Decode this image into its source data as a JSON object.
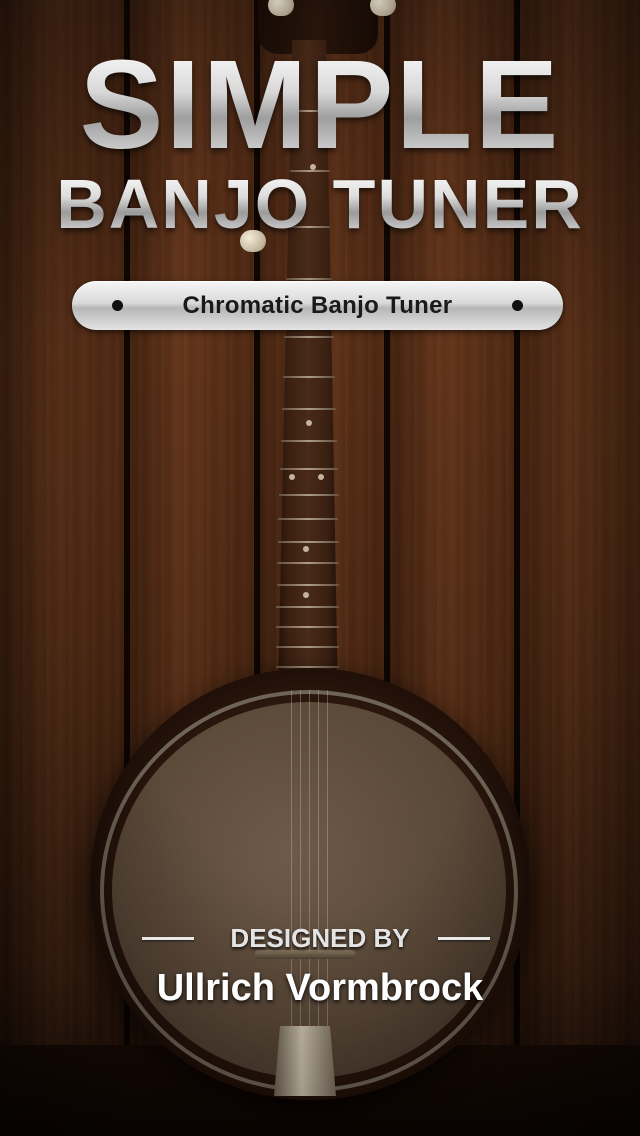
{
  "splash": {
    "title_line1": "SIMPLE",
    "title_line2": "BANJO TUNER",
    "subtitle": "Chromatic Banjo Tuner",
    "credit_label": "DESIGNED BY",
    "credit_name": "Ullrich Vormbrock"
  },
  "icons": {
    "background": "wood-planks-image",
    "instrument": "banjo-image",
    "subtitle_left": "bullet-dot-icon",
    "subtitle_right": "bullet-dot-icon"
  },
  "colors": {
    "wood": "#4a2512",
    "title_metal": "#dcdcdc",
    "pill": "#d9d9d9",
    "pill_text": "#1a1a1a",
    "credit_text": "#ffffff"
  }
}
